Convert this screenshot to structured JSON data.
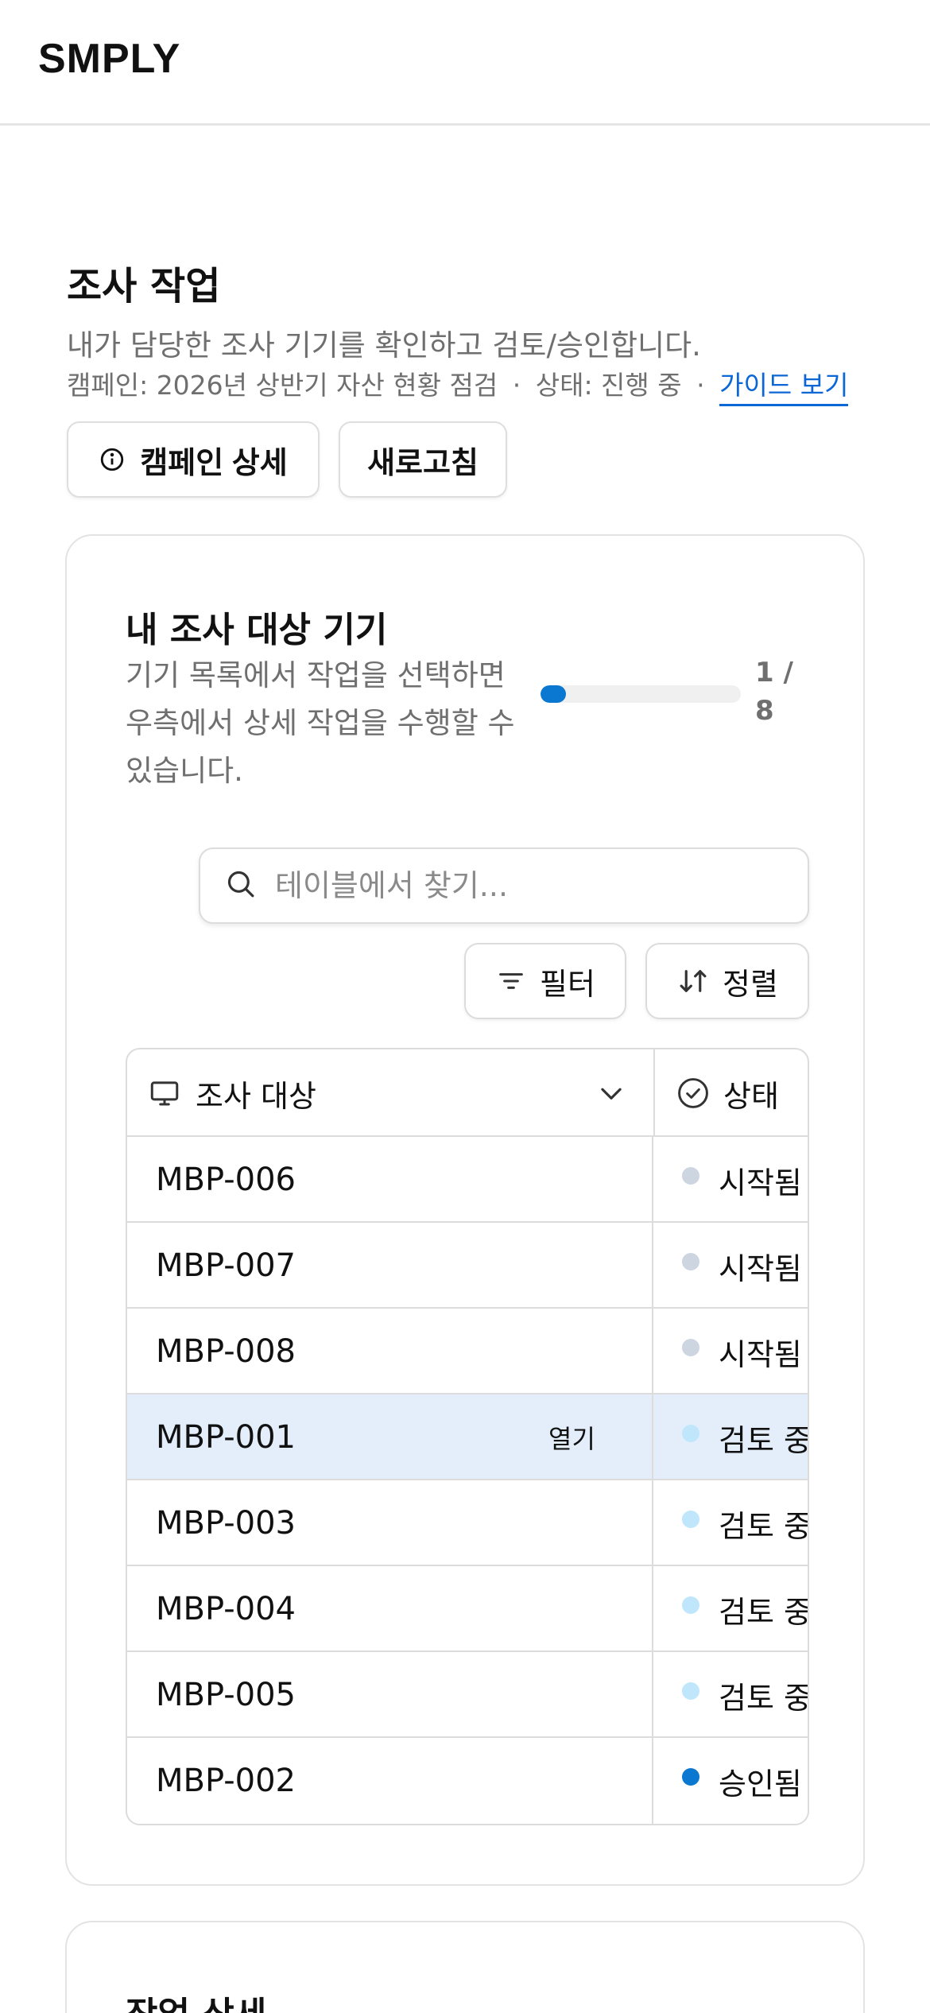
{
  "app": {
    "brand": "SMPLY"
  },
  "header": {
    "title": "조사 작업",
    "subtitle": "내가 담당한 조사 기기를 확인하고 검토/승인합니다.",
    "meta_campaign": "캠페인: 2026년 상반기 자산 현황 점검",
    "meta_separator": "·",
    "meta_status": "상태: 진행 중",
    "guide_link": "가이드 보기"
  },
  "actions": {
    "campaign_detail": "캠페인 상세",
    "refresh": "새로고침"
  },
  "panel": {
    "title": "내 조사 대상 기기",
    "description": "기기 목록에서 작업을 선택하면 우측에서 상세 작업을 수행할 수 있습니다.",
    "progress_label": "1 / 8",
    "progress_fraction": 0.125
  },
  "search": {
    "placeholder": "테이블에서 찾기..."
  },
  "toolbar": {
    "filter": "필터",
    "sort": "정렬"
  },
  "table": {
    "columns": {
      "target": "조사 대상",
      "status": "상태"
    },
    "open_label": "열기",
    "rows": [
      {
        "device": "MBP-006",
        "status": "시작됨",
        "status_color": "#cdd5e0",
        "selected": false
      },
      {
        "device": "MBP-007",
        "status": "시작됨",
        "status_color": "#cdd5e0",
        "selected": false
      },
      {
        "device": "MBP-008",
        "status": "시작됨",
        "status_color": "#cdd5e0",
        "selected": false
      },
      {
        "device": "MBP-001",
        "status": "검토 중",
        "status_color": "#bfe6fb",
        "selected": true
      },
      {
        "device": "MBP-003",
        "status": "검토 중",
        "status_color": "#bfe6fb",
        "selected": false
      },
      {
        "device": "MBP-004",
        "status": "검토 중",
        "status_color": "#bfe6fb",
        "selected": false
      },
      {
        "device": "MBP-005",
        "status": "검토 중",
        "status_color": "#bfe6fb",
        "selected": false
      },
      {
        "device": "MBP-002",
        "status": "승인됨",
        "status_color": "#0a78d1",
        "selected": false
      }
    ]
  },
  "detail_panel": {
    "title": "작업 상세"
  },
  "colors": {
    "accent": "#0a78d1",
    "link": "#0b66d6",
    "selected_row": "#e3eefa"
  }
}
